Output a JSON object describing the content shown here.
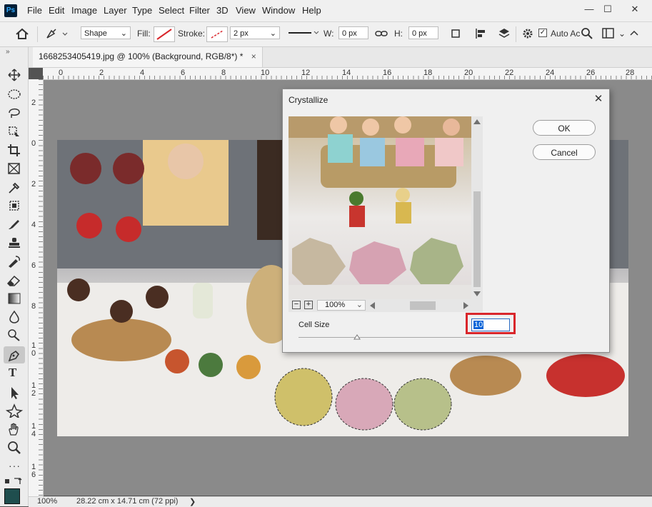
{
  "app": {
    "logo": "Ps"
  },
  "menu": [
    "File",
    "Edit",
    "Image",
    "Layer",
    "Type",
    "Select",
    "Filter",
    "3D",
    "View",
    "Window",
    "Help"
  ],
  "window_controls": {
    "minimize": "—",
    "maximize": "☐",
    "close": "✕"
  },
  "options": {
    "shape_mode": "Shape",
    "fill_label": "Fill:",
    "stroke_label": "Stroke:",
    "stroke_width": "2 px",
    "w_label": "W:",
    "w_value": "0 px",
    "h_label": "H:",
    "h_value": "0 px",
    "auto_align": "Auto Ac"
  },
  "document_tab": {
    "title": "1668253405419.jpg @ 100% (Background, RGB/8*) *",
    "close": "×"
  },
  "ruler_h": [
    "0",
    "2",
    "4",
    "6",
    "8",
    "10",
    "12",
    "14",
    "16",
    "18",
    "20",
    "22",
    "24",
    "26",
    "28"
  ],
  "ruler_v": [
    "2",
    "0",
    "2",
    "4",
    "6",
    "8",
    "1 0",
    "1 2",
    "1 4",
    "1 6"
  ],
  "status": {
    "zoom": "100%",
    "size": "28.22 cm x 14.71 cm (72 ppi)",
    "arrow": "❯"
  },
  "dialog": {
    "title": "Crystallize",
    "close": "✕",
    "ok": "OK",
    "cancel": "Cancel",
    "zoom": "100%",
    "zoom_minus": "−",
    "zoom_plus": "+",
    "cell_size_label": "Cell Size",
    "cell_size_value": "10",
    "cell_size_slider": {
      "value": 10,
      "min": 3,
      "max": 300
    }
  },
  "colors": {
    "highlight": "#d9262b",
    "foreground": "#1f4e4e",
    "selection": "#0a64d8"
  }
}
